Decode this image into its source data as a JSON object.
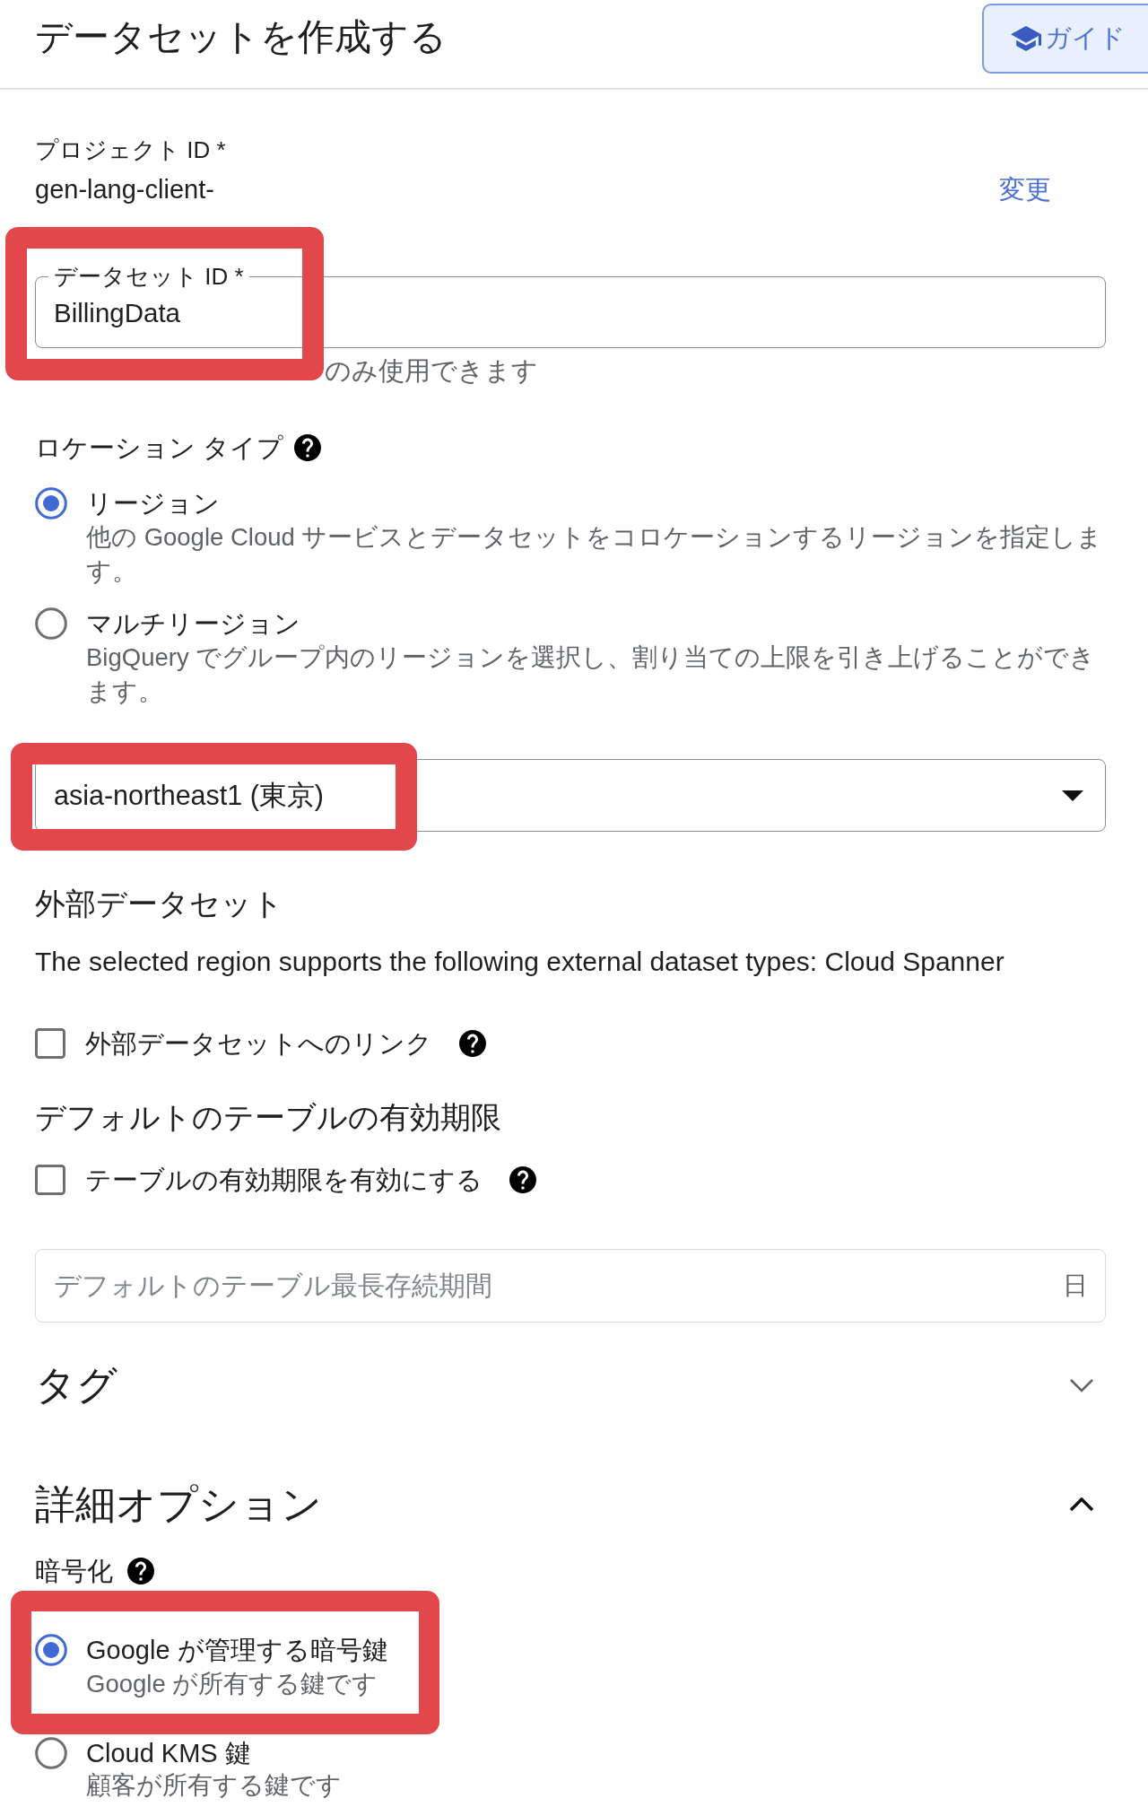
{
  "header": {
    "title": "データセットを作成する",
    "guide_button": "ガイド"
  },
  "project": {
    "label": "プロジェクト ID *",
    "value": "gen-lang-client-",
    "change_link": "変更"
  },
  "dataset_id": {
    "label": "データセット ID *",
    "value": "BillingData",
    "helper": "のみ使用できます",
    "highlighted": true
  },
  "location_type": {
    "label": "ロケーション タイプ",
    "options": [
      {
        "label": "リージョン",
        "description": "他の Google Cloud サービスとデータセットをコロケーションするリージョンを指定します。",
        "selected": true
      },
      {
        "label": "マルチリージョン",
        "description": "BigQuery でグループ内のリージョンを選択し、割り当ての上限を引き上げることができます。",
        "selected": false
      }
    ]
  },
  "region": {
    "value": "asia-northeast1 (東京)",
    "highlighted": true
  },
  "external_dataset": {
    "heading": "外部データセット",
    "note": "The selected region supports the following external dataset types: Cloud Spanner",
    "link_checkbox": {
      "label": "外部データセットへのリンク",
      "checked": false
    }
  },
  "table_expiration": {
    "heading": "デフォルトのテーブルの有効期限",
    "checkbox": {
      "label": "テーブルの有効期限を有効にする",
      "checked": false
    },
    "duration_field": {
      "placeholder": "デフォルトのテーブル最長存続期間",
      "suffix": "日"
    }
  },
  "tags": {
    "title": "タグ",
    "expanded": false
  },
  "advanced_options": {
    "title": "詳細オプション",
    "expanded": true,
    "encryption": {
      "label": "暗号化",
      "options": [
        {
          "label": "Google が管理する暗号鍵",
          "description": "Google が所有する鍵です",
          "selected": true,
          "highlighted": true
        },
        {
          "label": "Cloud KMS 鍵",
          "description": "顧客が所有する鍵です",
          "selected": false,
          "highlighted": false
        }
      ]
    }
  }
}
